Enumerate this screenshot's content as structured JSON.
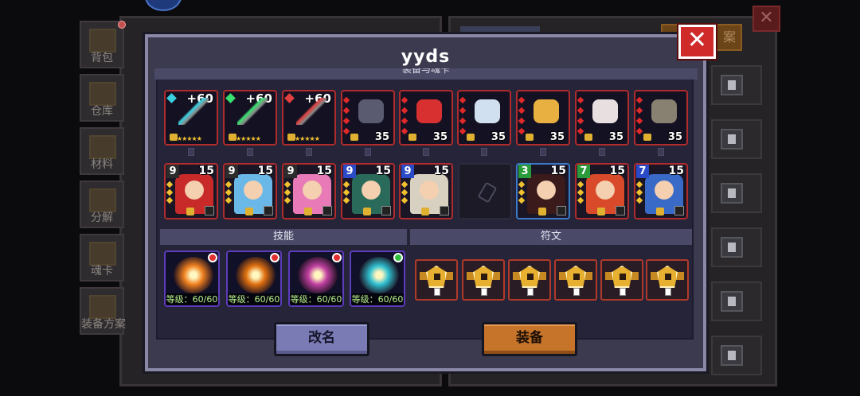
{
  "modal": {
    "title": "yyds",
    "section_equipment": "装备与魂卡",
    "section_skills": "技能",
    "section_runes": "符文",
    "close_label": "✕",
    "rename_button": "改名",
    "equip_button": "装备"
  },
  "background": {
    "close_label": "✕",
    "scheme_button_partial": "案",
    "side_tabs": [
      "背包",
      "仓库",
      "材料",
      "分解",
      "魂卡",
      "装备方案"
    ]
  },
  "weapons": [
    {
      "plus": "+60",
      "gem_color": "#3ad0e0",
      "stars": "★★★★★"
    },
    {
      "plus": "+60",
      "gem_color": "#3ae070",
      "stars": "★★★★★"
    },
    {
      "plus": "+60",
      "gem_color": "#e04040",
      "stars": "★★★★★"
    }
  ],
  "armor": [
    {
      "level": "35"
    },
    {
      "level": "35"
    },
    {
      "level": "35"
    },
    {
      "level": "35"
    },
    {
      "level": "35"
    },
    {
      "level": "35"
    }
  ],
  "cards": [
    {
      "star_count": "9",
      "level": "15",
      "theme": "#c82a2a"
    },
    {
      "star_count": "9",
      "level": "15",
      "theme": "#6ab8e8"
    },
    {
      "star_count": "9",
      "level": "15",
      "theme": "#e87ab8"
    },
    {
      "star_count": "9",
      "level": "15",
      "theme": "#2a6a5a"
    },
    {
      "star_count": "9",
      "level": "15",
      "theme": "#d8d0c0"
    },
    {
      "star_count": "3",
      "level": "15",
      "theme": "#3a1a1a"
    },
    {
      "star_count": "7",
      "level": "15",
      "theme": "#d84a2a"
    },
    {
      "star_count": "7",
      "level": "15",
      "theme": "#3a6ac8"
    }
  ],
  "skills": [
    {
      "label": "等级：60/60",
      "color": "#f08020",
      "corner": "#e03030"
    },
    {
      "label": "等级：60/60",
      "color": "#e07010",
      "corner": "#e03030"
    },
    {
      "label": "等级：60/60",
      "color": "#c040a0",
      "corner": "#e03030"
    },
    {
      "label": "等级：60/60",
      "color": "#30c0d0",
      "corner": "#30c040"
    }
  ],
  "rune_count": 6
}
